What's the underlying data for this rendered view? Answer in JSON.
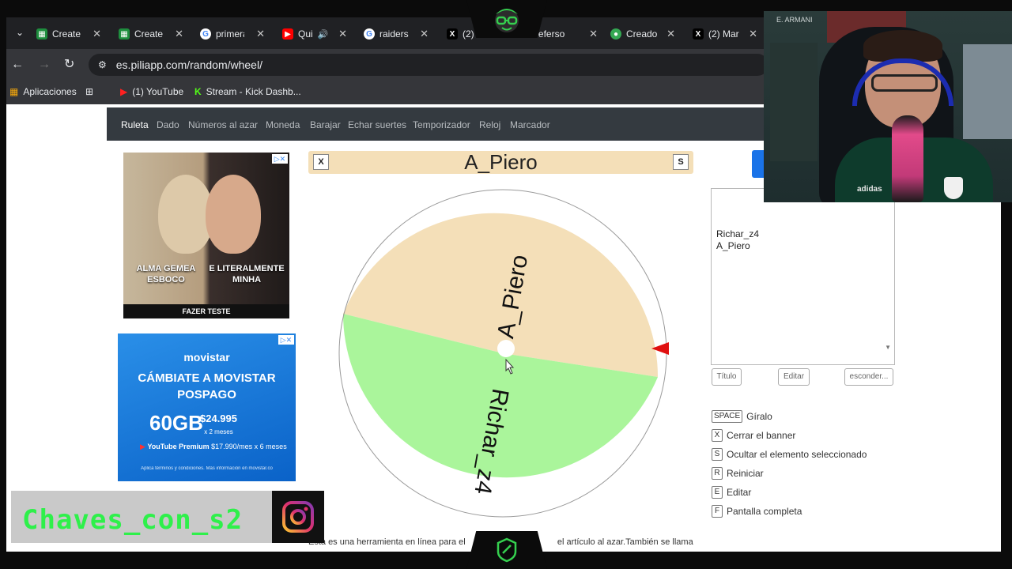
{
  "browser": {
    "tabs": [
      {
        "label": "Create",
        "favicon": "sheets-icon",
        "color": "#1e8e3e"
      },
      {
        "label": "Create",
        "favicon": "sheets-icon",
        "color": "#1e8e3e"
      },
      {
        "label": "primera",
        "favicon": "google-icon",
        "color": "#4285f4"
      },
      {
        "label": "Qui",
        "favicon": "youtube-icon",
        "color": "#ff0000"
      },
      {
        "label": "raiders",
        "favicon": "google-icon",
        "color": "#4285f4"
      },
      {
        "label": "(2)",
        "favicon": "x-icon",
        "color": "#000000"
      },
      {
        "label": "Yeferso",
        "favicon": "x-icon",
        "color": "#000000"
      },
      {
        "label": "Creado",
        "favicon": "soccer-icon",
        "color": "#34a853"
      },
      {
        "label": "(2) Mar",
        "favicon": "x-icon",
        "color": "#000000"
      }
    ],
    "url": "es.piliapp.com/random/wheel/",
    "bookmarks": [
      {
        "label": "Aplicaciones"
      },
      {
        "label": "(1) YouTube"
      },
      {
        "label": "Stream - Kick Dashb..."
      }
    ]
  },
  "site_nav": {
    "items": [
      "Ruleta",
      "Dado",
      "Números al azar",
      "Moneda",
      "Barajar",
      "Echar suertes",
      "Temporizador",
      "Reloj",
      "Marcador"
    ]
  },
  "ads": {
    "ad1": {
      "left_caption": "ALMA GEMEA ESBOCO",
      "right_caption": "E LITERALMENTE MINHA",
      "cta": "FAZER TESTE"
    },
    "ad2": {
      "brand": "movistar",
      "headline": "CÁMBIATE A MOVISTAR POSPAGO",
      "gb": "60GB",
      "price": "$24.995",
      "price_sub": "x 2 meses",
      "youtube": "YouTube Premium",
      "youtube_price": "$17.990/mes x 6 meses",
      "fine_print": "Aplica términos y condiciones. Más información en movistar.co"
    }
  },
  "overlay": {
    "stream_name": "Chaves_con_s2"
  },
  "wheel": {
    "winner": "A_Piero",
    "close_key": "X",
    "hide_key": "S",
    "segments": [
      {
        "label": "A_Piero",
        "color": "#f4dfb8"
      },
      {
        "label": "Richar_z4",
        "color": "#aaf59b"
      }
    ],
    "pointer_color": "#e01010"
  },
  "entries": {
    "lines": [
      "Richar_z4",
      "A_Piero"
    ],
    "buttons": [
      "Título",
      "Editar",
      "esconder..."
    ]
  },
  "shortcuts": [
    {
      "key": "SPACE",
      "label": "Gíralo"
    },
    {
      "key": "X",
      "label": "Cerrar el banner"
    },
    {
      "key": "S",
      "label": "Ocultar el elemento seleccionado"
    },
    {
      "key": "R",
      "label": "Reiniciar"
    },
    {
      "key": "E",
      "label": "Editar"
    },
    {
      "key": "F",
      "label": "Pantalla completa"
    }
  ],
  "footer_text": "Esta es una herramienta en línea para el",
  "footer_text_right": "el artículo al azar.También se llama",
  "webcam": {
    "brand_text": "adidas",
    "corner_text": "E. ARMANI"
  }
}
